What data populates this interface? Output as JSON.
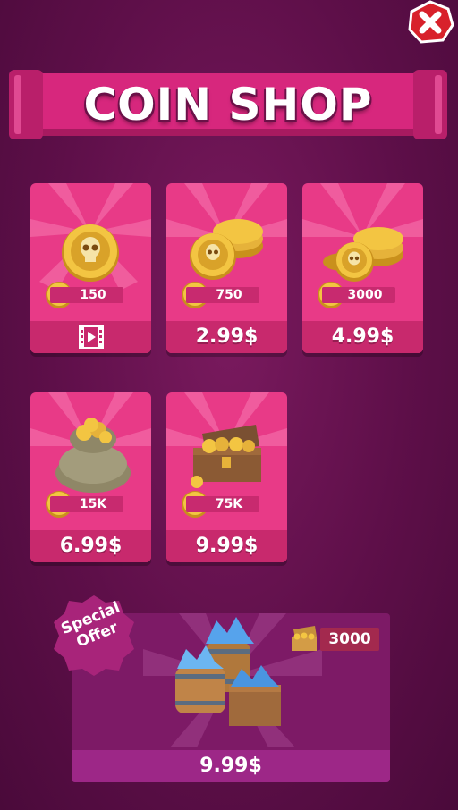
{
  "title": "COIN SHOP",
  "close": {
    "icon": "close-icon"
  },
  "colors": {
    "card": "#e83a87",
    "card_bar": "#c8296d",
    "background": "#5e0f49",
    "special_panel": "#7d1a66"
  },
  "packs": [
    {
      "amount": "150",
      "price_icon": "video-ad-icon",
      "art_icon": "single-skull-coin-icon"
    },
    {
      "amount": "750",
      "price": "2.99$",
      "art_icon": "coin-stack-icon"
    },
    {
      "amount": "3000",
      "price": "4.99$",
      "art_icon": "coin-pile-icon"
    },
    {
      "amount": "15K",
      "price": "6.99$",
      "art_icon": "coin-sack-icon"
    },
    {
      "amount": "75K",
      "price": "9.99$",
      "art_icon": "treasure-chest-icon"
    }
  ],
  "special_offer": {
    "badge": "Special Offer",
    "badge_line1": "Special",
    "badge_line2": "Offer",
    "amount": "3000",
    "price": "9.99$",
    "art_icon": "gem-barrels-icon"
  }
}
